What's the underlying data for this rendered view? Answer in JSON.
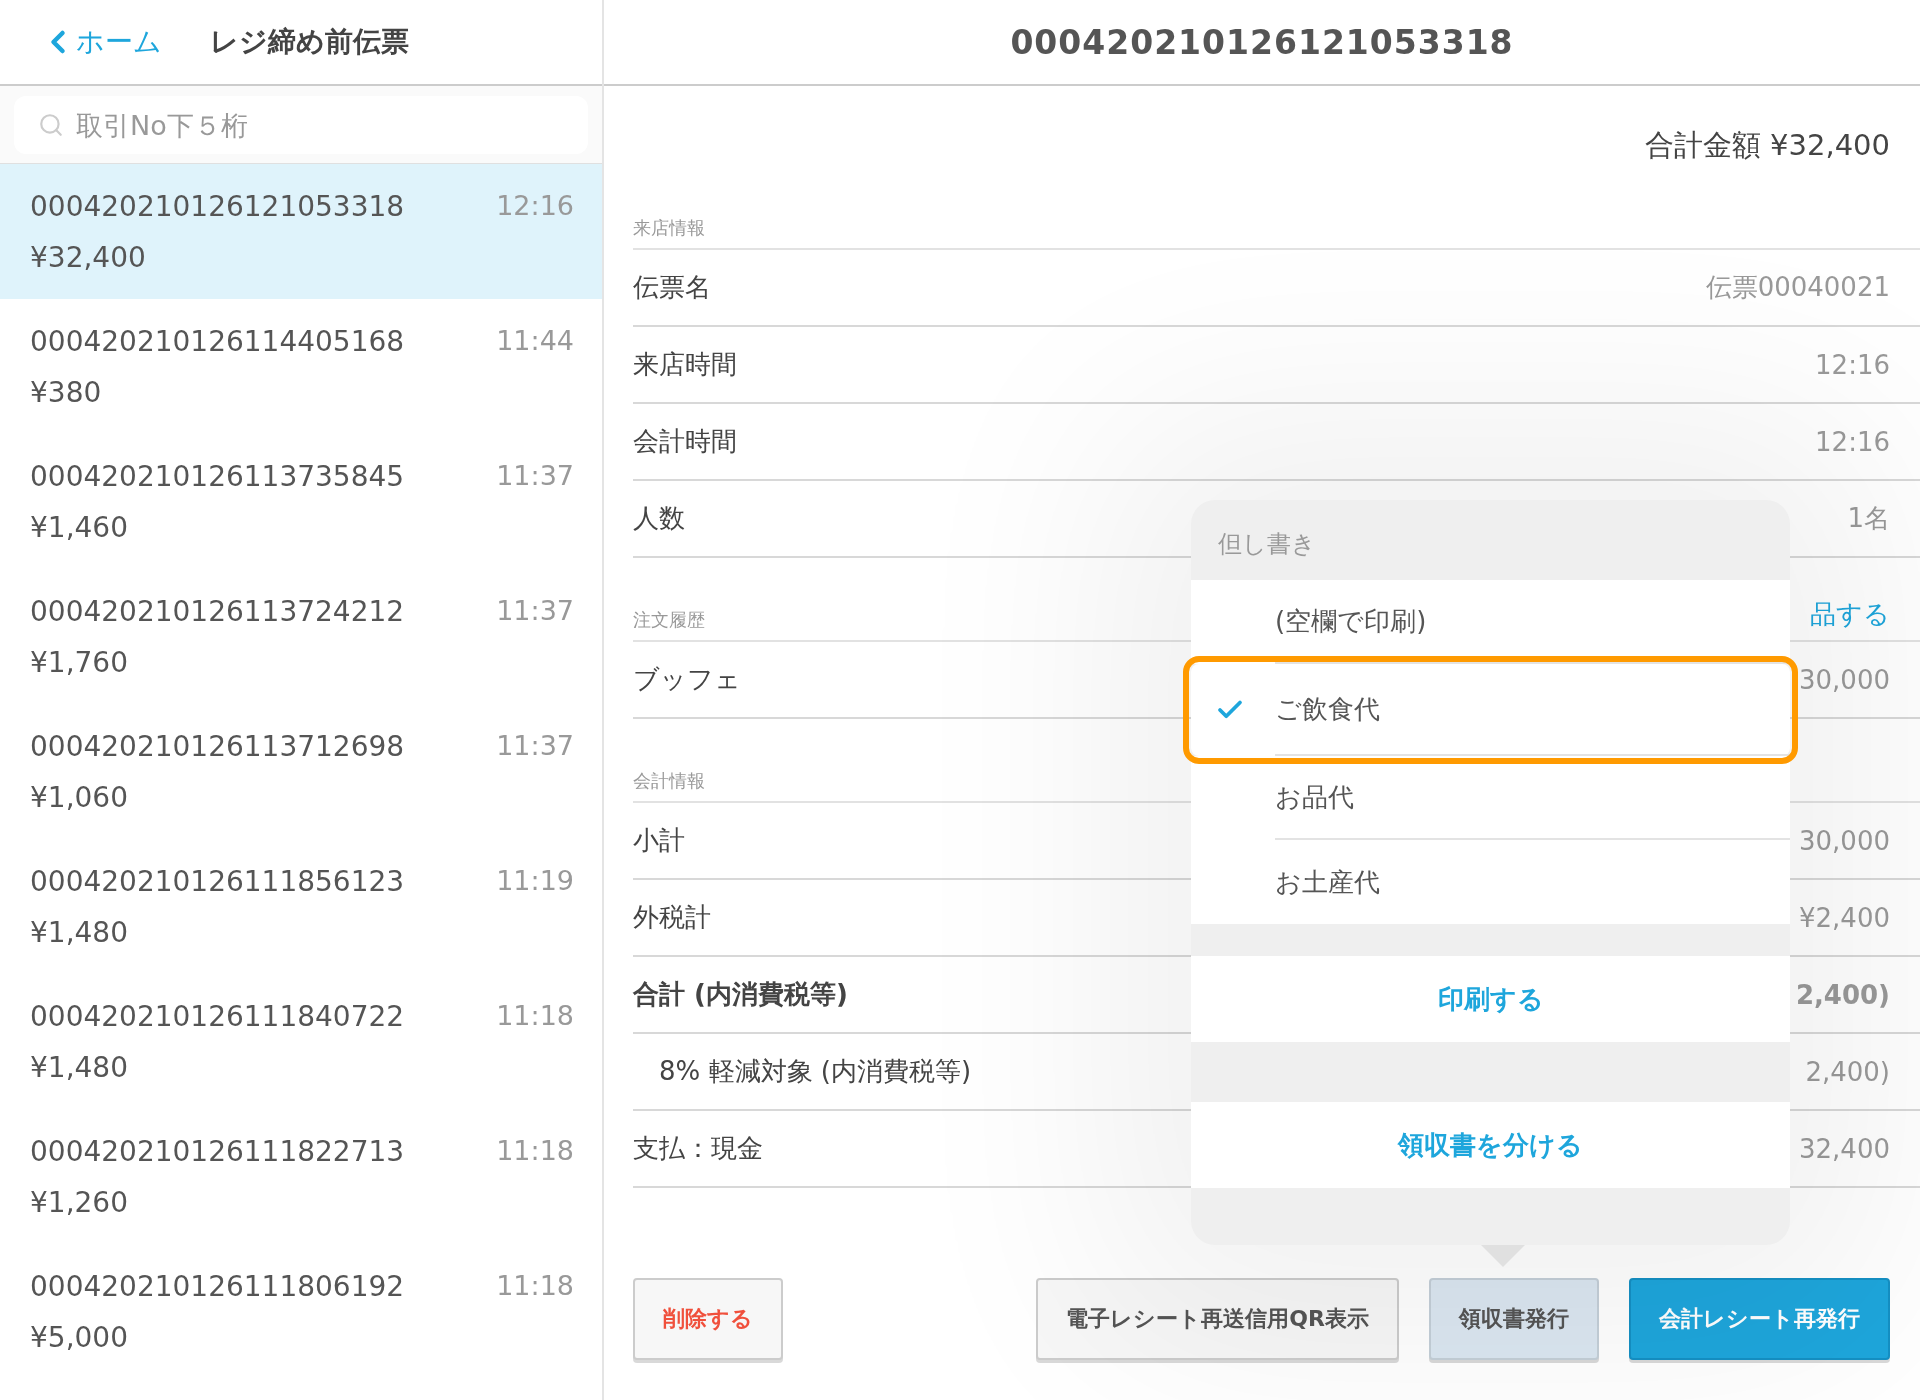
{
  "header": {
    "back_label": "ホーム",
    "title": "レジ締め前伝票",
    "detail_title": "000420210126121053318"
  },
  "search": {
    "placeholder": "取引No下５桁"
  },
  "transactions": [
    {
      "number": "000420210126121053318",
      "time": "12:16",
      "amount": "¥32,400",
      "selected": true
    },
    {
      "number": "000420210126114405168",
      "time": "11:44",
      "amount": "¥380",
      "selected": false
    },
    {
      "number": "000420210126113735845",
      "time": "11:37",
      "amount": "¥1,460",
      "selected": false
    },
    {
      "number": "000420210126113724212",
      "time": "11:37",
      "amount": "¥1,760",
      "selected": false
    },
    {
      "number": "000420210126113712698",
      "time": "11:37",
      "amount": "¥1,060",
      "selected": false
    },
    {
      "number": "000420210126111856123",
      "time": "11:19",
      "amount": "¥1,480",
      "selected": false
    },
    {
      "number": "000420210126111840722",
      "time": "11:18",
      "amount": "¥1,480",
      "selected": false
    },
    {
      "number": "000420210126111822713",
      "time": "11:18",
      "amount": "¥1,260",
      "selected": false
    },
    {
      "number": "000420210126111806192",
      "time": "11:18",
      "amount": "¥5,000",
      "selected": false
    }
  ],
  "detail": {
    "total": "合計金額 ¥32,400",
    "sections": [
      {
        "label": "来店情報",
        "rows": [
          {
            "label": "伝票名",
            "value": "伝票00040021",
            "kind": "normal"
          },
          {
            "label": "来店時間",
            "value": "12:16",
            "kind": "normal"
          },
          {
            "label": "会計時間",
            "value": "12:16",
            "kind": "normal"
          },
          {
            "label": "人数",
            "value": "1名",
            "kind": "normal"
          }
        ]
      },
      {
        "label": "注文履歴",
        "action": "品する",
        "rows": [
          {
            "label": "ブッフェ",
            "value": "30,000",
            "kind": "normal"
          }
        ]
      },
      {
        "label": "会計情報",
        "rows": [
          {
            "label": "小計",
            "value": "30,000",
            "kind": "normal"
          },
          {
            "label": "外税計",
            "value": "¥2,400",
            "kind": "normal"
          },
          {
            "label": "合計 (内消費税等)",
            "value": "2,400)",
            "kind": "bold"
          },
          {
            "label": "8% 軽減対象 (内消費税等)",
            "value": "2,400)",
            "kind": "indent"
          },
          {
            "label": "支払：現金",
            "value": "32,400",
            "kind": "normal"
          }
        ]
      }
    ]
  },
  "popover": {
    "title": "但し書き",
    "options": [
      {
        "label": "(空欄で印刷)",
        "selected": false,
        "highlighted": false
      },
      {
        "label": "ご飲食代",
        "selected": true,
        "highlighted": true
      },
      {
        "label": "お品代",
        "selected": false,
        "highlighted": false
      },
      {
        "label": "お土産代",
        "selected": false,
        "highlighted": false
      }
    ],
    "actions": [
      "印刷する",
      "領収書を分ける"
    ]
  },
  "buttons": [
    {
      "label": "削除する",
      "kind": "danger"
    },
    {
      "label": "電子レシート再送信用QR表示",
      "kind": "default"
    },
    {
      "label": "領収書発行",
      "kind": "active"
    },
    {
      "label": "会計レシート再発行",
      "kind": "primary"
    }
  ]
}
